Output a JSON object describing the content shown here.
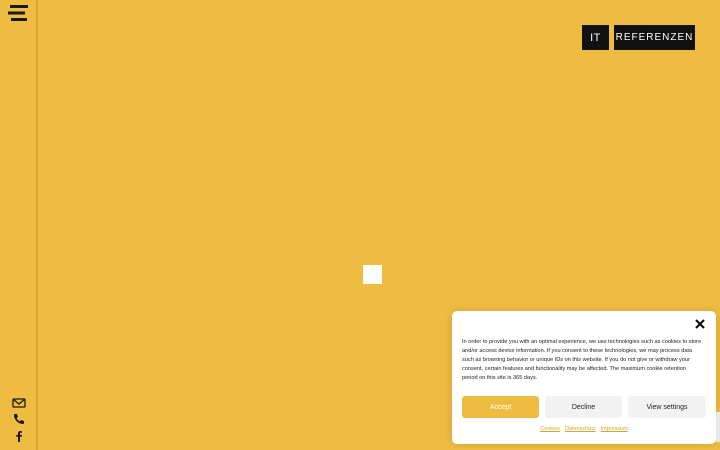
{
  "header": {
    "language_button": "IT",
    "references_button": "REFERENZEN"
  },
  "sidebar": {
    "menu_icon": "hamburger-menu-icon",
    "icons": [
      "envelope-icon",
      "phone-icon",
      "facebook-icon"
    ]
  },
  "cookie_banner": {
    "text": "In order to provide you with an optimal experience, we use technologies such as cookies to store and/or access device information. If you consent to these technologies, we may process data such as browsing behavior or unique IDs on this website. If you do not give or withdraw your consent, certain features and functionality may be affected. The maximum cookie retention period on this site is 365 days.",
    "accept_label": "Accept",
    "decline_label": "Decline",
    "view_settings_label": "View settings",
    "links": [
      "Cookies",
      "Datenschutz",
      "Impressum"
    ]
  },
  "colors": {
    "background": "#efbc42",
    "button_dark": "#111111",
    "accent": "#efbc42"
  }
}
